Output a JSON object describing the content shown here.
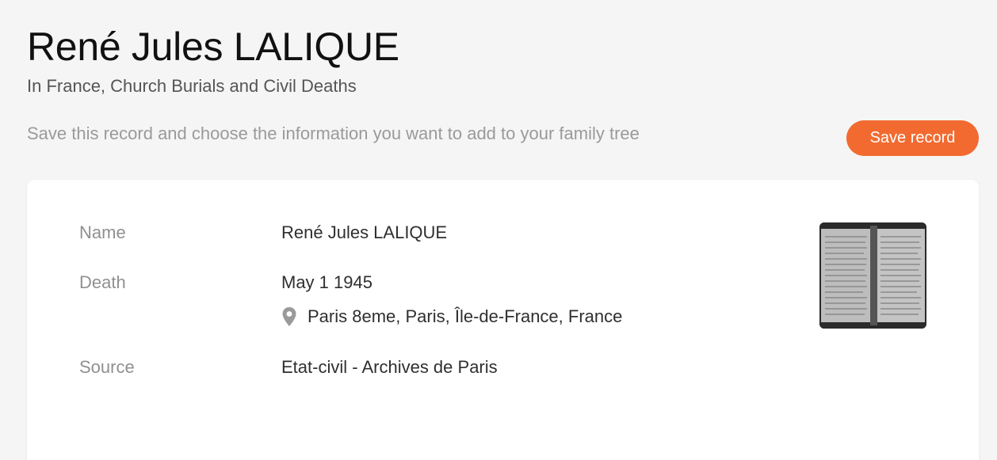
{
  "header": {
    "title": "René Jules LALIQUE",
    "collection": "In France, Church Burials and Civil Deaths",
    "save_hint": "Save this record and choose the information you want to add to your family tree",
    "save_button_label": "Save record"
  },
  "record": {
    "name_label": "Name",
    "name_value": "René Jules LALIQUE",
    "death_label": "Death",
    "death_date": "May 1 1945",
    "death_place": "Paris 8eme, Paris, Île-de-France, France",
    "source_label": "Source",
    "source_value": "Etat-civil - Archives de Paris",
    "place_icon": "map-pin-icon",
    "image_icon": "record-image-thumbnail"
  },
  "colors": {
    "accent": "#f26a30",
    "background": "#f5f5f5",
    "card": "#ffffff"
  }
}
